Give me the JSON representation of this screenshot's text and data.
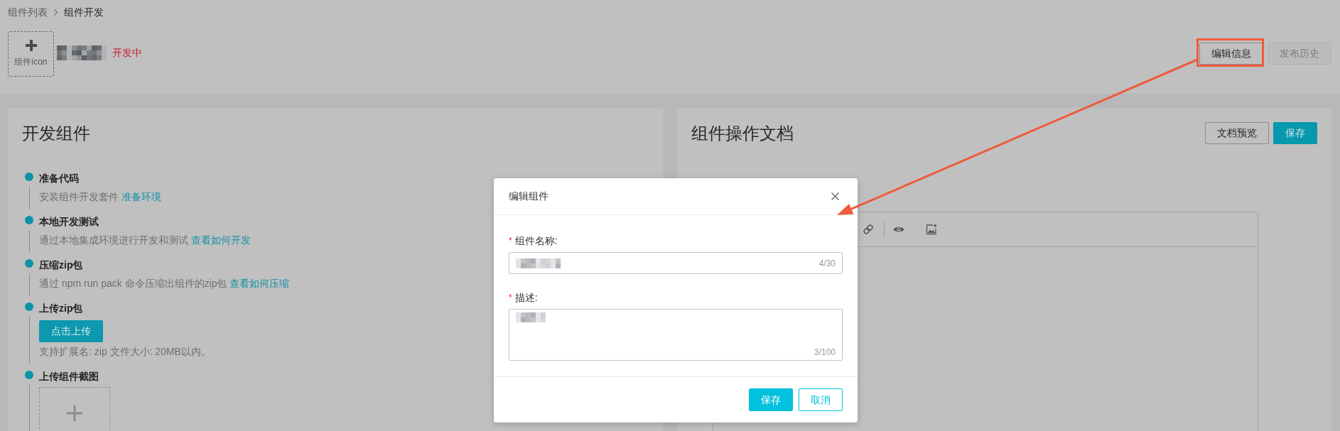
{
  "breadcrumb": [
    {
      "label": "组件列表",
      "current": false
    },
    {
      "label": "组件开发",
      "current": true
    }
  ],
  "component": {
    "icon_label": "组件icon",
    "status": "开发中"
  },
  "header_actions": [
    {
      "label": "编辑信息",
      "disabled": false,
      "highlighted": true
    },
    {
      "label": "发布历史",
      "disabled": true,
      "highlighted": false
    }
  ],
  "dev_panel": {
    "title": "开发组件",
    "steps": [
      {
        "kind": "text",
        "title": "准备代码",
        "description": "安装组件开发套件",
        "link": "准备环境"
      },
      {
        "kind": "text",
        "title": "本地开发测试",
        "description": "通过本地集成环境进行开发和测试",
        "link": "查看如何开发"
      },
      {
        "kind": "text",
        "title": "压缩zip包",
        "description": "通过 npm run pack 命令压缩出组件的zip包",
        "link": "查看如何压缩"
      },
      {
        "kind": "upload",
        "title": "上传zip包",
        "button": "点击上传",
        "hint": "支持扩展名: zip 文件大小: 20MB以内。"
      },
      {
        "kind": "image",
        "title": "上传组件截图"
      }
    ]
  },
  "doc_panel": {
    "title": "组件操作文档",
    "buttons": [
      {
        "label": "文档预览",
        "kind": "default"
      },
      {
        "label": "保存",
        "kind": "primary"
      }
    ]
  },
  "dialog": {
    "title": "编辑组件",
    "fields": [
      {
        "kind": "input",
        "required_mark": "*",
        "label": "组件名称:",
        "counter": "4/30"
      },
      {
        "kind": "textarea",
        "required_mark": "*",
        "label": "描述:",
        "counter": "3/100"
      }
    ],
    "buttons": [
      {
        "label": "保存",
        "kind": "primary"
      },
      {
        "label": "取消",
        "kind": "secondary"
      }
    ]
  }
}
